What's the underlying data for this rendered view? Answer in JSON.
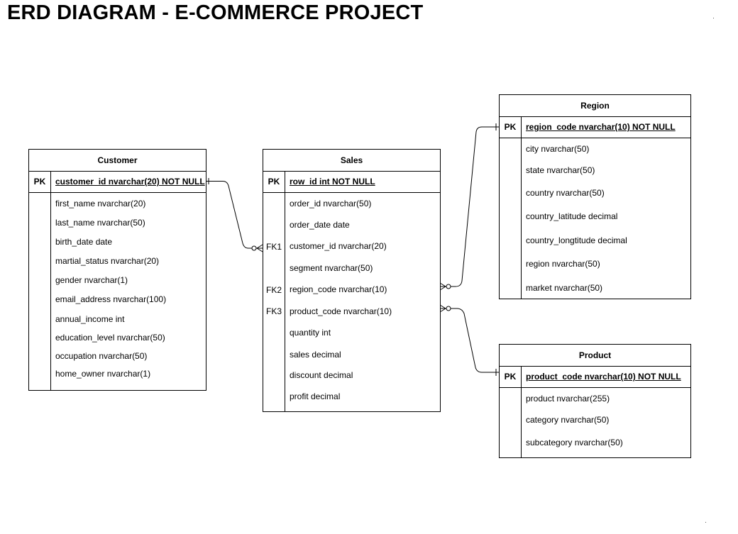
{
  "title": "ERD DIAGRAM - E-COMMERCE PROJECT",
  "entities": {
    "customer": {
      "name": "Customer",
      "pk_label": "PK",
      "pk_field": "customer_id nvarchar(20) NOT NULL",
      "attributes": [
        "first_name nvarchar(20)",
        "last_name nvarchar(50)",
        "birth_date date",
        "martial_status nvarchar(20)",
        "gender nvarchar(1)",
        "email_address nvarchar(100)",
        "annual_income int",
        "education_level nvarchar(50)",
        "occupation nvarchar(50)",
        "home_owner nvarchar(1)"
      ]
    },
    "sales": {
      "name": "Sales",
      "pk_label": "PK",
      "pk_field": "row_id int NOT NULL",
      "attributes": [
        "order_id nvarchar(50)",
        "order_date date",
        "customer_id nvarchar(20)",
        "segment nvarchar(50)",
        "region_code nvarchar(10)",
        "product_code nvarchar(10)",
        "quantity int",
        "sales decimal",
        "discount decimal",
        "profit decimal"
      ],
      "fk_labels": [
        "FK1",
        "FK2",
        "FK3"
      ]
    },
    "region": {
      "name": "Region",
      "pk_label": "PK",
      "pk_field": "region_code nvarchar(10) NOT NULL",
      "attributes": [
        "city nvarchar(50)",
        "state nvarchar(50)",
        "country nvarchar(50)",
        "country_latitude decimal",
        "country_longtitude decimal",
        "region nvarchar(50)",
        "market nvarchar(50)"
      ]
    },
    "product": {
      "name": "Product",
      "pk_label": "PK",
      "pk_field": "product_code nvarchar(10) NOT NULL",
      "attributes": [
        "product nvarchar(255)",
        "category nvarchar(50)",
        "subcategory nvarchar(50)"
      ]
    }
  }
}
